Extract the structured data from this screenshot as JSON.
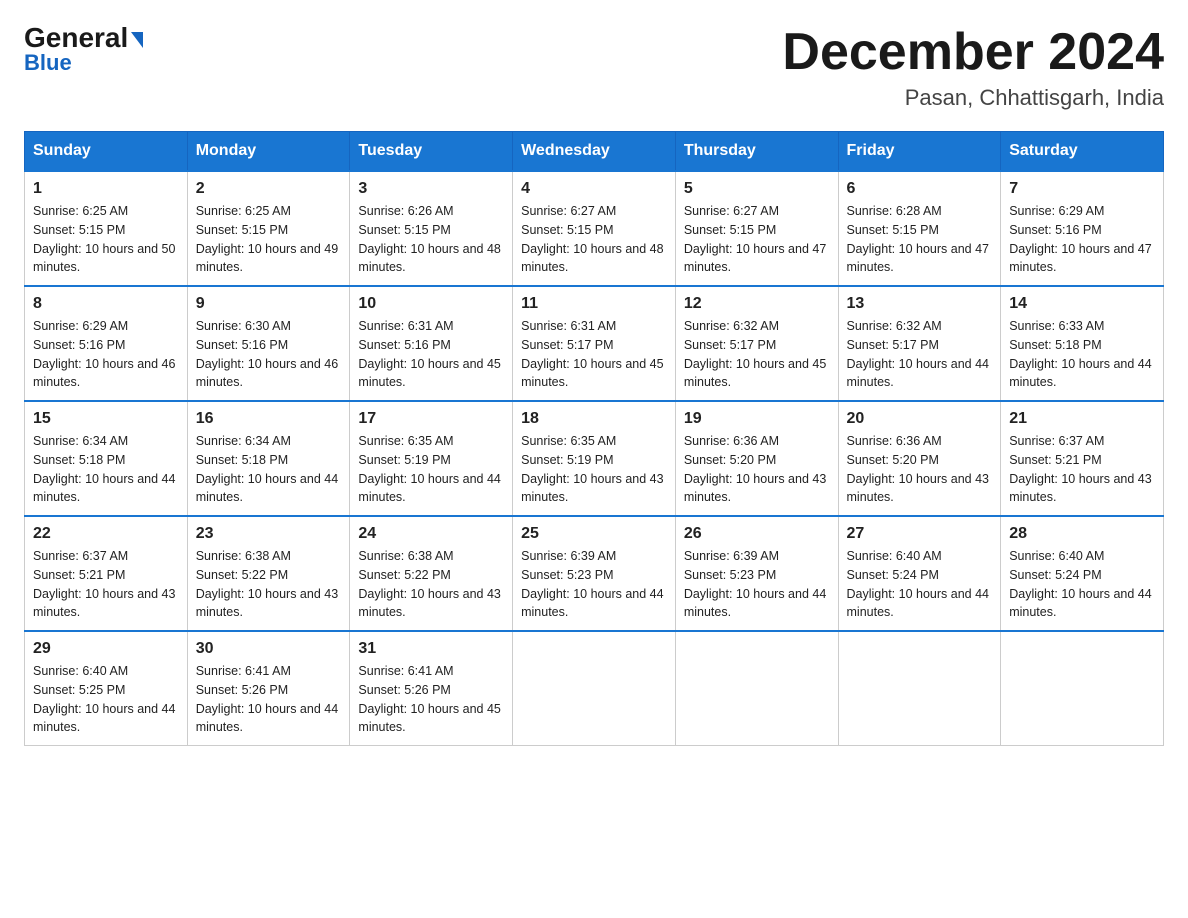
{
  "logo": {
    "general": "General",
    "blue": "Blue",
    "arrow": "▶"
  },
  "header": {
    "month_year": "December 2024",
    "location": "Pasan, Chhattisgarh, India"
  },
  "days_of_week": [
    "Sunday",
    "Monday",
    "Tuesday",
    "Wednesday",
    "Thursday",
    "Friday",
    "Saturday"
  ],
  "weeks": [
    [
      {
        "day": "1",
        "sunrise": "6:25 AM",
        "sunset": "5:15 PM",
        "daylight": "10 hours and 50 minutes."
      },
      {
        "day": "2",
        "sunrise": "6:25 AM",
        "sunset": "5:15 PM",
        "daylight": "10 hours and 49 minutes."
      },
      {
        "day": "3",
        "sunrise": "6:26 AM",
        "sunset": "5:15 PM",
        "daylight": "10 hours and 48 minutes."
      },
      {
        "day": "4",
        "sunrise": "6:27 AM",
        "sunset": "5:15 PM",
        "daylight": "10 hours and 48 minutes."
      },
      {
        "day": "5",
        "sunrise": "6:27 AM",
        "sunset": "5:15 PM",
        "daylight": "10 hours and 47 minutes."
      },
      {
        "day": "6",
        "sunrise": "6:28 AM",
        "sunset": "5:15 PM",
        "daylight": "10 hours and 47 minutes."
      },
      {
        "day": "7",
        "sunrise": "6:29 AM",
        "sunset": "5:16 PM",
        "daylight": "10 hours and 47 minutes."
      }
    ],
    [
      {
        "day": "8",
        "sunrise": "6:29 AM",
        "sunset": "5:16 PM",
        "daylight": "10 hours and 46 minutes."
      },
      {
        "day": "9",
        "sunrise": "6:30 AM",
        "sunset": "5:16 PM",
        "daylight": "10 hours and 46 minutes."
      },
      {
        "day": "10",
        "sunrise": "6:31 AM",
        "sunset": "5:16 PM",
        "daylight": "10 hours and 45 minutes."
      },
      {
        "day": "11",
        "sunrise": "6:31 AM",
        "sunset": "5:17 PM",
        "daylight": "10 hours and 45 minutes."
      },
      {
        "day": "12",
        "sunrise": "6:32 AM",
        "sunset": "5:17 PM",
        "daylight": "10 hours and 45 minutes."
      },
      {
        "day": "13",
        "sunrise": "6:32 AM",
        "sunset": "5:17 PM",
        "daylight": "10 hours and 44 minutes."
      },
      {
        "day": "14",
        "sunrise": "6:33 AM",
        "sunset": "5:18 PM",
        "daylight": "10 hours and 44 minutes."
      }
    ],
    [
      {
        "day": "15",
        "sunrise": "6:34 AM",
        "sunset": "5:18 PM",
        "daylight": "10 hours and 44 minutes."
      },
      {
        "day": "16",
        "sunrise": "6:34 AM",
        "sunset": "5:18 PM",
        "daylight": "10 hours and 44 minutes."
      },
      {
        "day": "17",
        "sunrise": "6:35 AM",
        "sunset": "5:19 PM",
        "daylight": "10 hours and 44 minutes."
      },
      {
        "day": "18",
        "sunrise": "6:35 AM",
        "sunset": "5:19 PM",
        "daylight": "10 hours and 43 minutes."
      },
      {
        "day": "19",
        "sunrise": "6:36 AM",
        "sunset": "5:20 PM",
        "daylight": "10 hours and 43 minutes."
      },
      {
        "day": "20",
        "sunrise": "6:36 AM",
        "sunset": "5:20 PM",
        "daylight": "10 hours and 43 minutes."
      },
      {
        "day": "21",
        "sunrise": "6:37 AM",
        "sunset": "5:21 PM",
        "daylight": "10 hours and 43 minutes."
      }
    ],
    [
      {
        "day": "22",
        "sunrise": "6:37 AM",
        "sunset": "5:21 PM",
        "daylight": "10 hours and 43 minutes."
      },
      {
        "day": "23",
        "sunrise": "6:38 AM",
        "sunset": "5:22 PM",
        "daylight": "10 hours and 43 minutes."
      },
      {
        "day": "24",
        "sunrise": "6:38 AM",
        "sunset": "5:22 PM",
        "daylight": "10 hours and 43 minutes."
      },
      {
        "day": "25",
        "sunrise": "6:39 AM",
        "sunset": "5:23 PM",
        "daylight": "10 hours and 44 minutes."
      },
      {
        "day": "26",
        "sunrise": "6:39 AM",
        "sunset": "5:23 PM",
        "daylight": "10 hours and 44 minutes."
      },
      {
        "day": "27",
        "sunrise": "6:40 AM",
        "sunset": "5:24 PM",
        "daylight": "10 hours and 44 minutes."
      },
      {
        "day": "28",
        "sunrise": "6:40 AM",
        "sunset": "5:24 PM",
        "daylight": "10 hours and 44 minutes."
      }
    ],
    [
      {
        "day": "29",
        "sunrise": "6:40 AM",
        "sunset": "5:25 PM",
        "daylight": "10 hours and 44 minutes."
      },
      {
        "day": "30",
        "sunrise": "6:41 AM",
        "sunset": "5:26 PM",
        "daylight": "10 hours and 44 minutes."
      },
      {
        "day": "31",
        "sunrise": "6:41 AM",
        "sunset": "5:26 PM",
        "daylight": "10 hours and 45 minutes."
      },
      null,
      null,
      null,
      null
    ]
  ]
}
